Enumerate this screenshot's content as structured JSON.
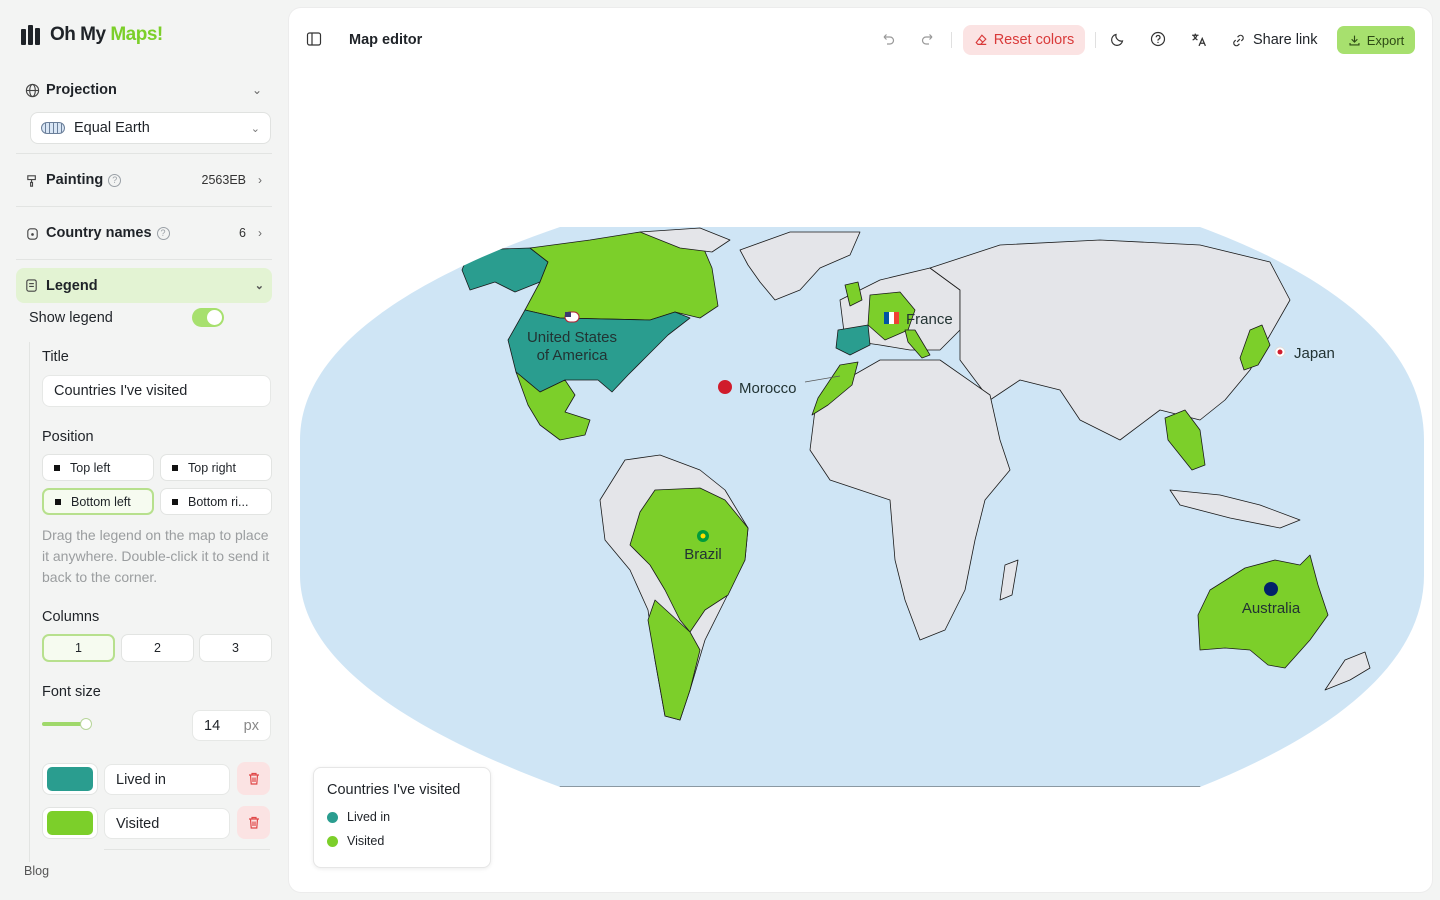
{
  "app": {
    "name_part1": "Oh My",
    "name_part2": "Maps!"
  },
  "sidebar": {
    "projection": {
      "label": "Projection",
      "value": "Equal Earth"
    },
    "painting": {
      "label": "Painting",
      "value": "2563EB"
    },
    "country_names": {
      "label": "Country names",
      "value": "6"
    },
    "legend": {
      "label": "Legend",
      "show_legend_label": "Show legend",
      "show_legend": true,
      "title_label": "Title",
      "title_value": "Countries I've visited",
      "position_label": "Position",
      "positions": [
        "Top left",
        "Top right",
        "Bottom left",
        "Bottom ri..."
      ],
      "selected_position": "Bottom left",
      "hint": "Drag the legend on the map to place it anywhere. Double-click it to send it back to the corner.",
      "columns_label": "Columns",
      "columns": [
        "1",
        "2",
        "3"
      ],
      "selected_columns": "1",
      "font_size_label": "Font size",
      "font_size_value": "14",
      "font_size_unit": "px",
      "entries": [
        {
          "label": "Lived in",
          "color": "#2a9d8f"
        },
        {
          "label": "Visited",
          "color": "#7ccf2a"
        }
      ]
    },
    "footer_link": "Blog"
  },
  "toolbar": {
    "title": "Map editor",
    "reset_label": "Reset colors",
    "share_label": "Share link",
    "export_label": "Export",
    "icons": [
      "sidebar-toggle-icon",
      "undo-icon",
      "redo-icon",
      "eraser-icon",
      "moon-icon",
      "help-icon",
      "translate-icon",
      "link-icon",
      "download-icon"
    ]
  },
  "map": {
    "ocean_color": "#cfe5f5",
    "land_color": "#e4e5e9",
    "labels": {
      "usa": "United States",
      "usa2": "of America",
      "france": "France",
      "morocco": "Morocco",
      "japan": "Japan",
      "brazil": "Brazil",
      "australia": "Australia"
    },
    "marker_color": "#d01c2c"
  },
  "legend_card": {
    "title": "Countries I've visited",
    "items": [
      {
        "label": "Lived in",
        "color": "#2a9d8f"
      },
      {
        "label": "Visited",
        "color": "#7ccf2a"
      }
    ]
  }
}
